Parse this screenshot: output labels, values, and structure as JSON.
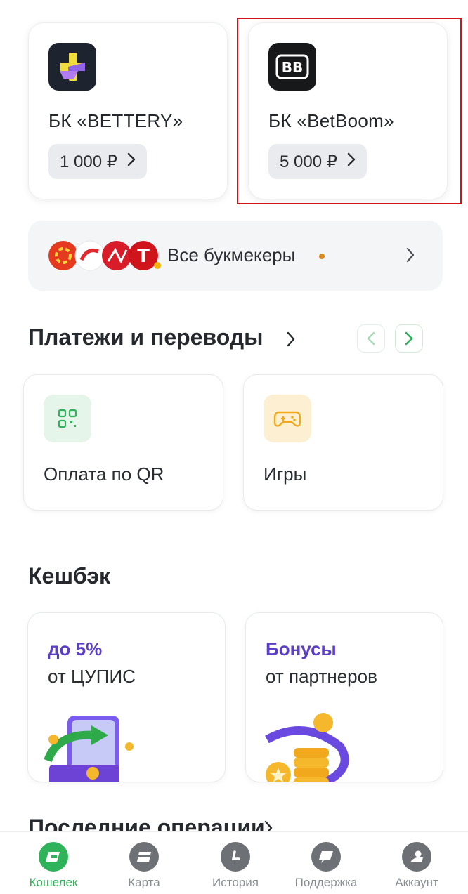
{
  "bookmakers": [
    {
      "title": "БК «BETTERY»",
      "amount": "1 000 ₽"
    },
    {
      "title": "БК «BetBoom»",
      "amount": "5 000 ₽"
    }
  ],
  "all_bookmakers": {
    "label": "Все букмекеры"
  },
  "payments": {
    "title": "Платежи и переводы",
    "tiles": [
      {
        "label": "Оплата по QR"
      },
      {
        "label": "Игры"
      }
    ]
  },
  "cashback": {
    "title": "Кешбэк",
    "cards": [
      {
        "accent": "до 5%",
        "sub": "от ЦУПИС"
      },
      {
        "accent": "Бонусы",
        "sub": "от партнеров"
      }
    ]
  },
  "recent": {
    "title": "Последние операции"
  },
  "nav": {
    "items": [
      {
        "label": "Кошелек",
        "icon": "wallet-icon",
        "active": true
      },
      {
        "label": "Карта",
        "icon": "card-icon"
      },
      {
        "label": "История",
        "icon": "history-icon"
      },
      {
        "label": "Поддержка",
        "icon": "support-icon"
      },
      {
        "label": "Аккаунт",
        "icon": "account-icon"
      }
    ]
  },
  "colors": {
    "accent_green": "#2fb35a",
    "accent_purple": "#5b3fc4",
    "highlight_red": "#d0141b"
  }
}
